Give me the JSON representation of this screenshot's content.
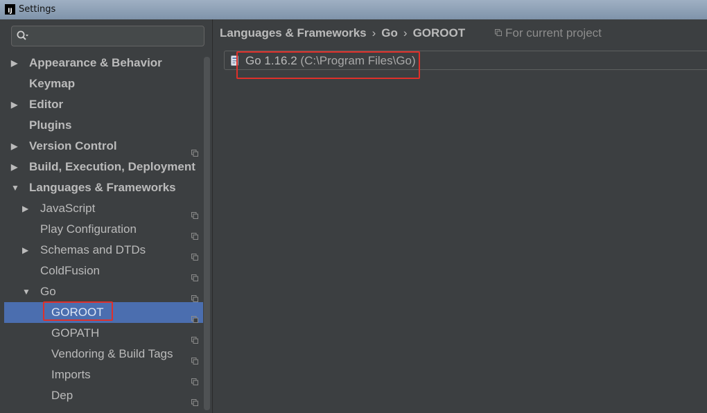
{
  "window": {
    "title": "Settings",
    "app_icon_text": "IJ"
  },
  "search": {
    "value": "",
    "placeholder": ""
  },
  "tree": [
    {
      "label": "Appearance & Behavior",
      "bold": true,
      "arrow": "right",
      "level": 0,
      "copy": false
    },
    {
      "label": "Keymap",
      "bold": true,
      "arrow": null,
      "level": 0,
      "copy": false
    },
    {
      "label": "Editor",
      "bold": true,
      "arrow": "right",
      "level": 0,
      "copy": false
    },
    {
      "label": "Plugins",
      "bold": true,
      "arrow": null,
      "level": 0,
      "copy": false
    },
    {
      "label": "Version Control",
      "bold": true,
      "arrow": "right",
      "level": 0,
      "copy": true
    },
    {
      "label": "Build, Execution, Deployment",
      "bold": true,
      "arrow": "right",
      "level": 0,
      "copy": false
    },
    {
      "label": "Languages & Frameworks",
      "bold": true,
      "arrow": "down",
      "level": 0,
      "copy": false
    },
    {
      "label": "JavaScript",
      "bold": false,
      "arrow": "right",
      "level": 1,
      "copy": true
    },
    {
      "label": "Play Configuration",
      "bold": false,
      "arrow": null,
      "level": 1,
      "copy": true
    },
    {
      "label": "Schemas and DTDs",
      "bold": false,
      "arrow": "right",
      "level": 1,
      "copy": true
    },
    {
      "label": "ColdFusion",
      "bold": false,
      "arrow": null,
      "level": 1,
      "copy": true
    },
    {
      "label": "Go",
      "bold": false,
      "arrow": "down",
      "level": 1,
      "copy": true
    },
    {
      "label": "GOROOT",
      "bold": false,
      "arrow": null,
      "level": 2,
      "copy": true,
      "selected": true
    },
    {
      "label": "GOPATH",
      "bold": false,
      "arrow": null,
      "level": 2,
      "copy": true
    },
    {
      "label": "Vendoring & Build Tags",
      "bold": false,
      "arrow": null,
      "level": 2,
      "copy": true
    },
    {
      "label": "Imports",
      "bold": false,
      "arrow": null,
      "level": 2,
      "copy": true
    },
    {
      "label": "Dep",
      "bold": false,
      "arrow": null,
      "level": 2,
      "copy": true
    }
  ],
  "breadcrumb": {
    "part1": "Languages & Frameworks",
    "part2": "Go",
    "part3": "GOROOT",
    "separator": "›"
  },
  "scope_label": "For current project",
  "sdk": {
    "version": "Go 1.16.2",
    "path": "(C:\\Program Files\\Go)"
  },
  "colors": {
    "selection": "#4b6eaf",
    "highlight_border": "#e0302a",
    "background": "#3c3f41"
  },
  "icons": {
    "search": "search-icon",
    "copy": "copy-icon",
    "go_sdk": "go-sdk-icon"
  }
}
